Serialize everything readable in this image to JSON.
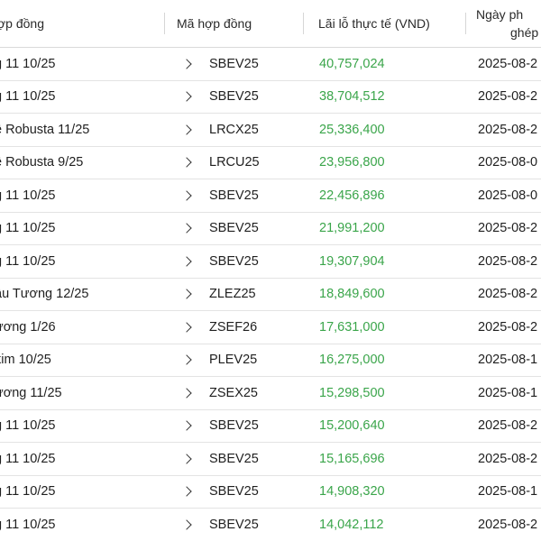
{
  "table": {
    "headers": {
      "name": "ợp đồng",
      "code": "Mã hợp đồng",
      "pnl": "Lãi lỗ thực tế (VND)",
      "date_line1": "Ngày ph",
      "date_line2": "ghép"
    },
    "rows": [
      {
        "name": "g 11 10/25",
        "code": "SBEV25",
        "pnl": "40,757,024",
        "date": "2025-08-2"
      },
      {
        "name": "g 11 10/25",
        "code": "SBEV25",
        "pnl": "38,704,512",
        "date": "2025-08-2"
      },
      {
        "name": "ê Robusta 11/25",
        "code": "LRCX25",
        "pnl": "25,336,400",
        "date": "2025-08-2"
      },
      {
        "name": "ê Robusta 9/25",
        "code": "LRCU25",
        "pnl": "23,956,800",
        "date": "2025-08-0"
      },
      {
        "name": "g 11 10/25",
        "code": "SBEV25",
        "pnl": "22,456,896",
        "date": "2025-08-0"
      },
      {
        "name": "g 11 10/25",
        "code": "SBEV25",
        "pnl": "21,991,200",
        "date": "2025-08-2"
      },
      {
        "name": "g 11 10/25",
        "code": "SBEV25",
        "pnl": "19,307,904",
        "date": "2025-08-2"
      },
      {
        "name": "ậu Tương 12/25",
        "code": "ZLEZ25",
        "pnl": "18,849,600",
        "date": "2025-08-2"
      },
      {
        "name": "ương 1/26",
        "code": "ZSEF26",
        "pnl": "17,631,000",
        "date": "2025-08-2"
      },
      {
        "name": "kim 10/25",
        "code": "PLEV25",
        "pnl": "16,275,000",
        "date": "2025-08-1"
      },
      {
        "name": "ương 11/25",
        "code": "ZSEX25",
        "pnl": "15,298,500",
        "date": "2025-08-1"
      },
      {
        "name": "g 11 10/25",
        "code": "SBEV25",
        "pnl": "15,200,640",
        "date": "2025-08-2"
      },
      {
        "name": "g 11 10/25",
        "code": "SBEV25",
        "pnl": "15,165,696",
        "date": "2025-08-2"
      },
      {
        "name": "g 11 10/25",
        "code": "SBEV25",
        "pnl": "14,908,320",
        "date": "2025-08-1"
      },
      {
        "name": "g 11 10/25",
        "code": "SBEV25",
        "pnl": "14,042,112",
        "date": "2025-08-2"
      }
    ]
  },
  "colors": {
    "profit_green": "#3aa54a",
    "row_border": "#e3e3e3"
  },
  "icons": {
    "row_expand": "chevron-right-icon"
  }
}
